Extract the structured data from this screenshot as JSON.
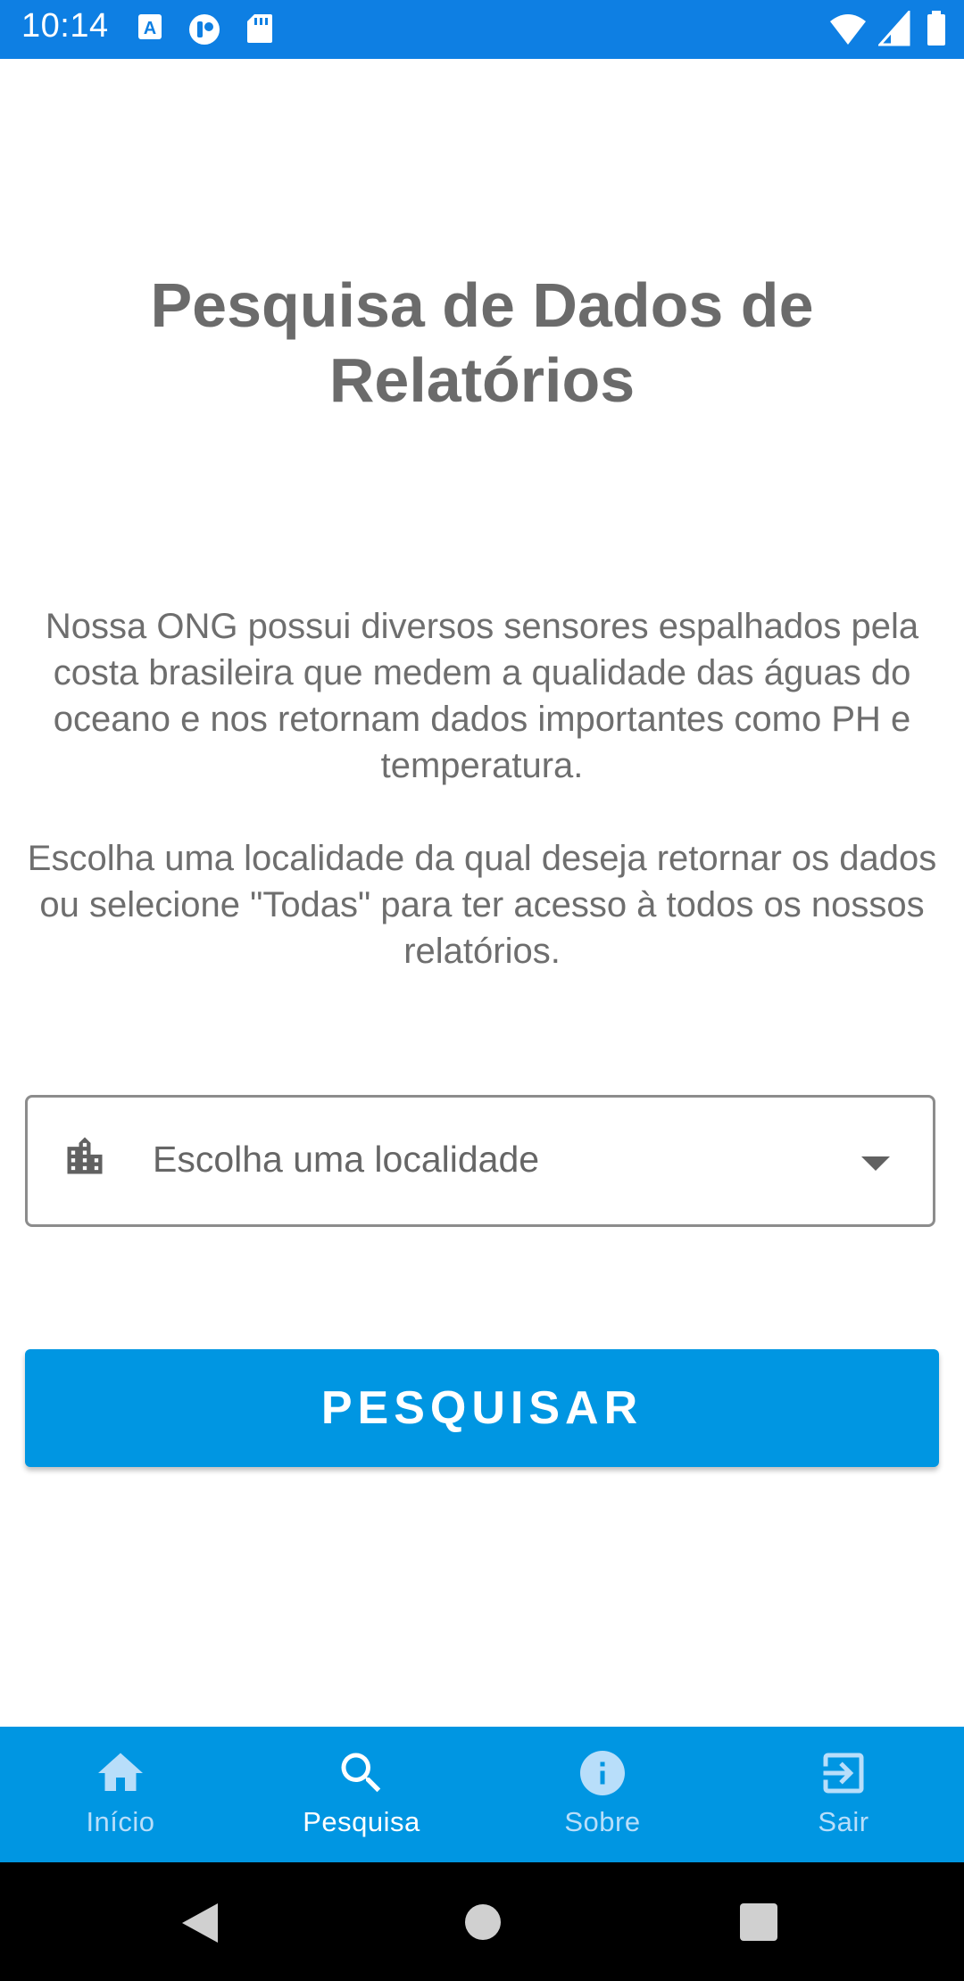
{
  "status_bar": {
    "time": "10:14",
    "icons": [
      "text-a-icon",
      "notification-app-icon",
      "sd-card-icon",
      "wifi-icon",
      "signal-icon",
      "battery-icon"
    ],
    "color": "#0e7fe3"
  },
  "page": {
    "title": "Pesquisa de Dados de Relatórios",
    "description_1": "Nossa ONG possui diversos sensores espalhados pela costa brasileira que medem a qualidade das águas do oceano e nos retornam dados importantes como PH e temperatura.",
    "description_2": "Escolha uma localidade da qual deseja retornar os dados ou selecione \"Todas\" para ter acesso à todos os nossos relatórios.",
    "location_select": {
      "placeholder": "Escolha uma localidade",
      "icon": "city-icon"
    },
    "search_button": "PESQUISAR",
    "accent_color": "#0096e2"
  },
  "bottom_nav": {
    "items": [
      {
        "label": "Início",
        "icon": "home-icon",
        "active": false
      },
      {
        "label": "Pesquisa",
        "icon": "search-icon",
        "active": true
      },
      {
        "label": "Sobre",
        "icon": "info-icon",
        "active": false
      },
      {
        "label": "Sair",
        "icon": "exit-icon",
        "active": false
      }
    ]
  },
  "system_nav": {
    "buttons": [
      "back-icon",
      "home-circle-icon",
      "recents-icon"
    ]
  }
}
